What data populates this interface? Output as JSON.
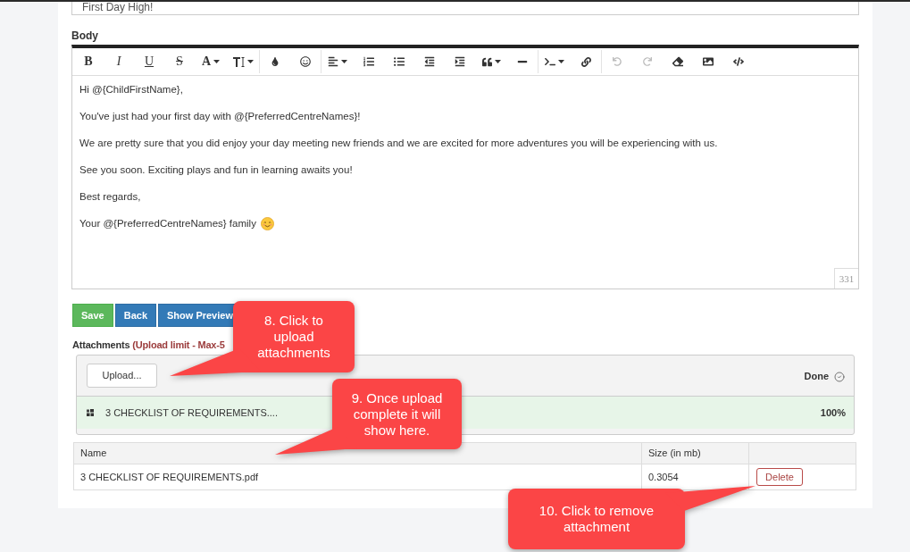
{
  "subject": {
    "value": "First Day High!"
  },
  "body": {
    "label": "Body",
    "toolbar": [
      [
        {
          "kind": "bold",
          "label": "B",
          "dropdown": false,
          "disabled": false
        },
        {
          "kind": "italic",
          "label": "I",
          "dropdown": false,
          "disabled": false
        },
        {
          "kind": "underline",
          "label": "U",
          "dropdown": false,
          "disabled": false
        },
        {
          "kind": "strikethrough",
          "label": "S",
          "dropdown": false,
          "disabled": false
        },
        {
          "kind": "font-name",
          "label": "A",
          "dropdown": true,
          "disabled": false
        },
        {
          "kind": "font-size",
          "dropdown": true,
          "disabled": false
        }
      ],
      [
        {
          "kind": "color",
          "dropdown": false,
          "disabled": false
        },
        {
          "kind": "emoji",
          "dropdown": false,
          "disabled": false
        }
      ],
      [
        {
          "kind": "paragraph",
          "dropdown": true,
          "disabled": false
        },
        {
          "kind": "ordered-list",
          "dropdown": false,
          "disabled": false
        },
        {
          "kind": "unordered-list",
          "dropdown": false,
          "disabled": false
        },
        {
          "kind": "outdent",
          "dropdown": false,
          "disabled": false
        },
        {
          "kind": "indent",
          "dropdown": false,
          "disabled": false
        },
        {
          "kind": "quote",
          "dropdown": true,
          "disabled": false
        },
        {
          "kind": "horizontal-rule",
          "dropdown": false,
          "disabled": false
        }
      ],
      [
        {
          "kind": "code-block",
          "dropdown": true,
          "disabled": false
        },
        {
          "kind": "link",
          "dropdown": false,
          "disabled": false
        }
      ],
      [
        {
          "kind": "undo",
          "dropdown": false,
          "disabled": true
        },
        {
          "kind": "redo",
          "dropdown": false,
          "disabled": true
        },
        {
          "kind": "eraser",
          "dropdown": false,
          "disabled": false
        },
        {
          "kind": "picture",
          "dropdown": false,
          "disabled": false
        },
        {
          "kind": "code-view",
          "dropdown": false,
          "disabled": false
        }
      ]
    ],
    "paragraphs": [
      {
        "text": "Hi @{ChildFirstName},",
        "emoji": false
      },
      {
        "text": "You've just had your first day with @{PreferredCentreNames}!",
        "emoji": false
      },
      {
        "text": "We are pretty sure that you did enjoy your day meeting new friends and we are excited for more adventures you will be experiencing with us.",
        "emoji": false
      },
      {
        "text": "See you soon. Exciting plays and fun in learning awaits you!",
        "emoji": false
      },
      {
        "text": "Best regards,",
        "emoji": false
      },
      {
        "text": "Your @{PreferredCentreNames} family",
        "emoji": true
      }
    ],
    "character_count": "331"
  },
  "buttons": [
    {
      "label": "Save",
      "kind": "success"
    },
    {
      "label": "Back",
      "kind": "primary"
    },
    {
      "label": "Show Preview",
      "kind": "primary"
    }
  ],
  "attachments": {
    "label": "Attachments",
    "limit": "(Upload limit - Max-5",
    "upload_button": "Upload...",
    "status": "Done",
    "files": [
      {
        "name": "3 CHECKLIST OF REQUIREMENTS....",
        "percent": "100%",
        "level": 1
      }
    ]
  },
  "table": {
    "columns": [
      "Name",
      "Size (in mb)"
    ],
    "rows": [
      {
        "name": "3 CHECKLIST OF REQUIREMENTS.pdf",
        "size": "0.3054",
        "action": "Delete"
      }
    ]
  },
  "callouts": [
    {
      "text": "8. Click to upload attachments"
    },
    {
      "text": "9. Once upload complete it will show here."
    },
    {
      "text": "10. Click to remove attachment"
    }
  ]
}
